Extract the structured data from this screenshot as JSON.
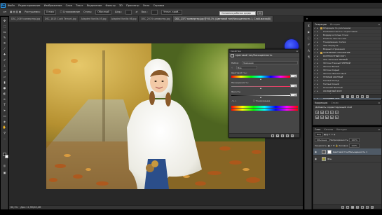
{
  "app": {
    "logo_text": "Ps"
  },
  "menubar": {
    "items": [
      "Файл",
      "Редактирование",
      "Изображение",
      "Слои",
      "Текст",
      "Выделение",
      "Фильтр",
      "3D",
      "Просмотр",
      "Окно",
      "Справка"
    ]
  },
  "options_bar": {
    "tool_label": "Растушевка:",
    "feather_value": "0 пикс",
    "antialias_label": "Сглаживание",
    "style_label": "Стиль:",
    "style_value": "Обычный",
    "width_label": "Шир.:",
    "height_label": "Выс.:",
    "refine_button": "Уточн. край...",
    "workspace_field": "Основная рабочая среда",
    "workspace_dropdown_icon": "chevron-down-icon"
  },
  "document_tabs": [
    {
      "label": "DSC_2049 конвертер.jpg",
      "active": false
    },
    {
      "label": "DSC_1813 Cucki Ternoni.jpg",
      "active": false
    },
    {
      "label": "Adapted Vanilla 05.jpg",
      "active": false
    },
    {
      "label": "Adapted Vanilla 06.jpg",
      "active": false
    },
    {
      "label": "DSC_2074 конвертер.jpg",
      "active": false
    },
    {
      "label": "DSC_2377 конвертер.jpg @ 60,1% (Цветовой тон/Насыщенность 1, Слой-маска/8)",
      "active": true
    }
  ],
  "status": {
    "zoom": "60,1%",
    "doc_info": "Док: 11,9M/45,4M"
  },
  "properties_dialog": {
    "header": "Свойства",
    "title": "Цветовой тон/Насыщенность",
    "preset_label": "Набор:",
    "preset_value": "Заказная",
    "channel_value": "Все",
    "hue_label": "Цветовой тон:",
    "hue_value": "0",
    "hue_level": 0.5,
    "saturation_label": "Насыщенность:",
    "saturation_value": "0",
    "saturation_level": 0.5,
    "lightness_label": "Яркость:",
    "lightness_value": "0",
    "lightness_level": 0.5,
    "colorize_label": "Тонирование"
  },
  "operations_panel": {
    "tabs": [
      {
        "label": "Операции",
        "active": true
      },
      {
        "label": "История",
        "active": false
      }
    ],
    "rows": [
      {
        "label": "Операции по умолчанию",
        "type": "folder",
        "checked": true
      },
      {
        "label": "Усиление текста с отростками",
        "type": "item",
        "checked": true
      },
      {
        "label": "Бордюр в полые точки",
        "type": "item",
        "checked": true
      },
      {
        "label": "Усилить тексты слоя",
        "type": "item",
        "checked": true
      },
      {
        "label": "Тонирование: Сепия",
        "type": "item",
        "checked": true
      },
      {
        "label": "Фон Формула",
        "type": "item",
        "checked": true
      },
      {
        "label": "Водный отражения",
        "type": "item",
        "checked": true
      },
      {
        "label": "ЗАТЕНЕНИЕ ОТРАЖЕНИЕ",
        "type": "folder",
        "checked": true
      },
      {
        "label": "КОНТРАСТНЫЙ ФОН",
        "type": "item",
        "checked": true
      },
      {
        "label": "Фон Зеленые ЧЕРНЫЙ",
        "type": "item",
        "checked": true
      },
      {
        "label": "Фотони Темный ЧЕРНЫЙ",
        "type": "item",
        "checked": true
      },
      {
        "label": "Фотони Белый",
        "type": "item",
        "checked": true
      },
      {
        "label": "Фотони Серый",
        "type": "item",
        "checked": true
      },
      {
        "label": "Фотони Фиолетовый",
        "type": "item",
        "checked": true
      },
      {
        "label": "ТЕПЛЫЙ ЖЕЛТЫЙ",
        "type": "item",
        "checked": true
      },
      {
        "label": "Теплый Холод",
        "type": "item",
        "checked": true
      },
      {
        "label": "Теплый Синий",
        "type": "item",
        "checked": true
      },
      {
        "label": "Осенний Желтый",
        "type": "item",
        "checked": true
      },
      {
        "label": "ХОЛОДНЫЙ ФОН",
        "type": "item",
        "checked": true
      },
      {
        "label": "НОВЫЙ ФОН",
        "type": "item",
        "checked": true
      },
      {
        "label": "Холодный Фон",
        "type": "item",
        "checked": true,
        "selected": true
      },
      {
        "label": "Серебристые",
        "type": "folder",
        "checked": true
      }
    ]
  },
  "adjustments_panel": {
    "tabs": [
      {
        "label": "Коррекция",
        "active": true
      },
      {
        "label": "Стили",
        "active": false
      }
    ],
    "text": "Добавить корректирующий слой"
  },
  "layers_panel": {
    "tabs": [
      {
        "label": "Слои",
        "active": true
      },
      {
        "label": "Каналы",
        "active": false
      },
      {
        "label": "Контуры",
        "active": false
      }
    ],
    "kind_label": "Вид",
    "blend_mode": "Обычные",
    "opacity_label": "Непрозрачность:",
    "opacity_value": "100%",
    "fill_label": "Заливка:",
    "fill_value": "100%",
    "lock_label": "Закрепить:",
    "layers": [
      {
        "name": "Цветовой тон/Насыщенность 1",
        "selected": true,
        "type": "adjustment"
      },
      {
        "name": "Фон",
        "selected": false,
        "type": "image"
      }
    ]
  }
}
